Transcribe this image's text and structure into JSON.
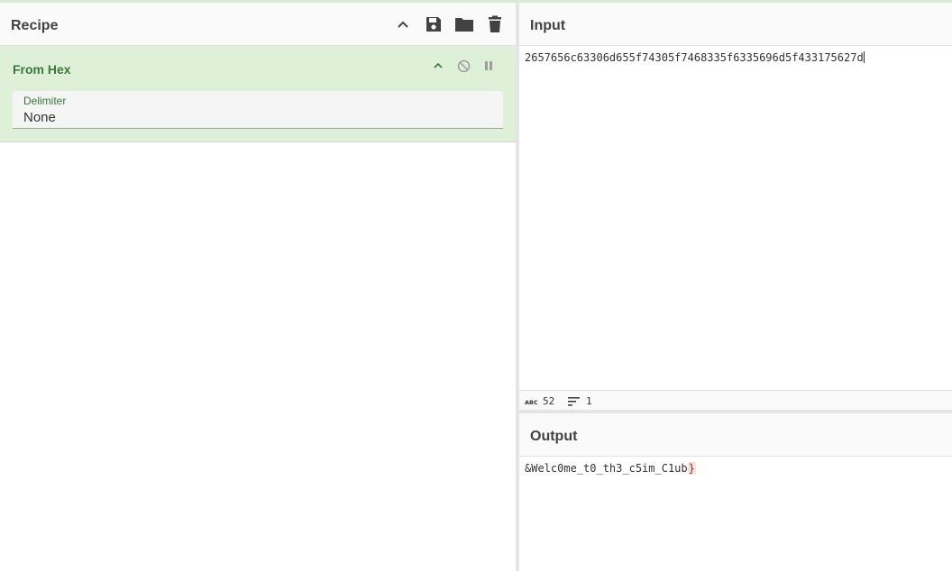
{
  "recipe": {
    "title": "Recipe",
    "controls": [
      "chevron-up-icon",
      "save-icon",
      "folder-icon",
      "trash-icon"
    ],
    "operation": {
      "name": "From Hex",
      "arg_label": "Delimiter",
      "arg_value": "None",
      "background": "#dff0d8",
      "title_color": "#3c763d"
    }
  },
  "input": {
    "title": "Input",
    "text": "2657656c63306d655f74305f7468335f6335696d5f433175627d",
    "stats": {
      "length": "52",
      "lines": "1"
    }
  },
  "output": {
    "title": "Output",
    "text_main": "&Welc0me_t0_th3_c5im_C1ub",
    "text_end": "}"
  }
}
